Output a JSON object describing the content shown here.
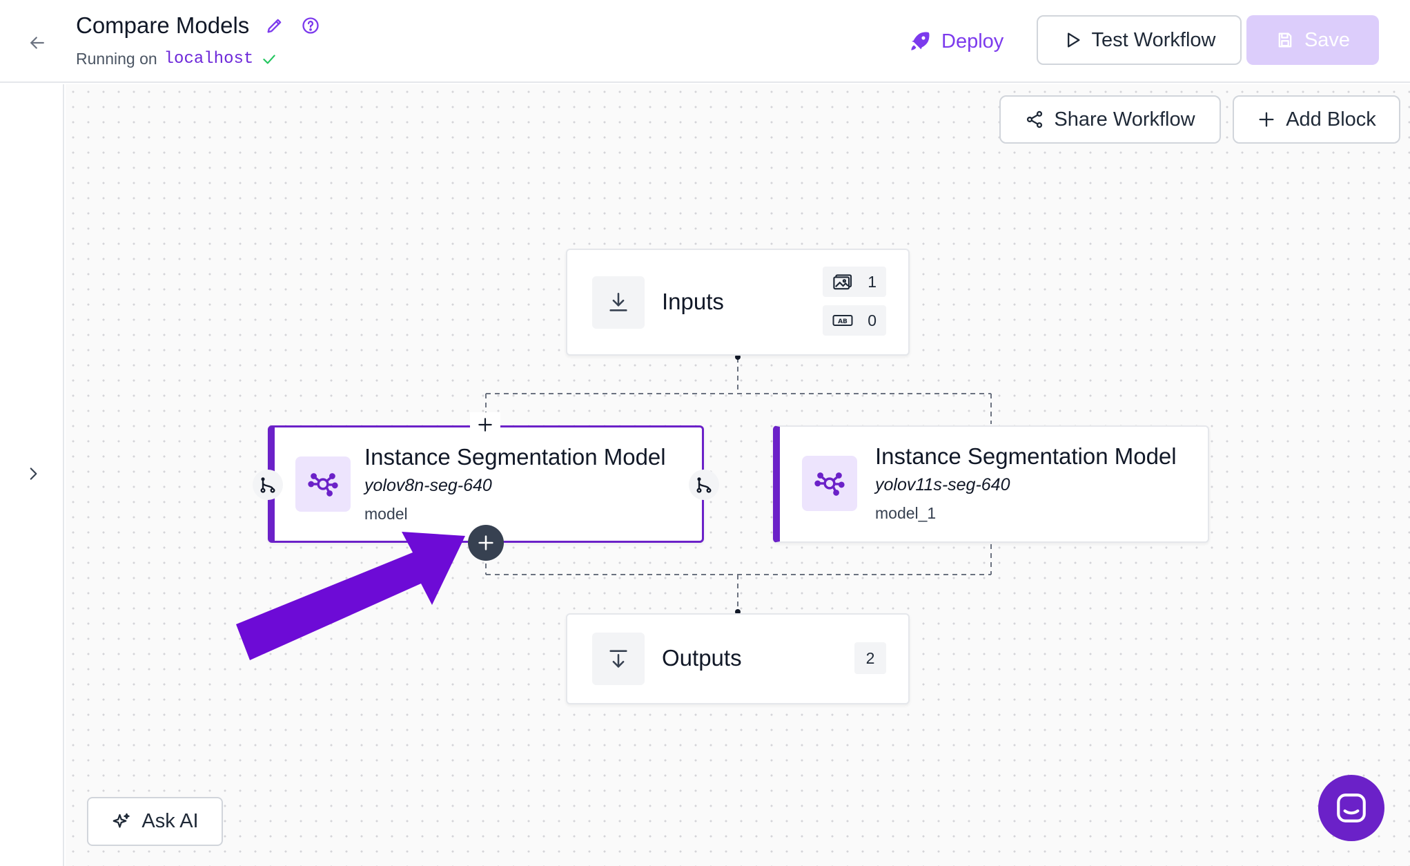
{
  "header": {
    "title": "Compare Models",
    "running_prefix": "Running on",
    "host": "localhost",
    "deploy_label": "Deploy",
    "test_label": "Test Workflow",
    "save_label": "Save"
  },
  "toolbar": {
    "share_label": "Share Workflow",
    "add_block_label": "Add Block"
  },
  "nodes": {
    "inputs": {
      "label": "Inputs",
      "image_count": "1",
      "param_count": "0"
    },
    "model1": {
      "title": "Instance Segmentation Model",
      "model_id": "yolov8n-seg-640",
      "name": "model"
    },
    "model2": {
      "title": "Instance Segmentation Model",
      "model_id": "yolov11s-seg-640",
      "name": "model_1"
    },
    "outputs": {
      "label": "Outputs",
      "count": "2"
    }
  },
  "ask_ai_label": "Ask AI",
  "colors": {
    "accent": "#7c3aed",
    "block_border": "#6b21c8",
    "arrow": "#6d0bd6"
  },
  "icons": [
    "back-arrow-icon",
    "pencil-icon",
    "help-icon",
    "check-icon",
    "rocket-icon",
    "play-icon",
    "save-icon",
    "share-icon",
    "plus-icon",
    "chevron-right-icon",
    "download-icon",
    "image-icon",
    "text-icon",
    "model-graph-icon",
    "branch-icon",
    "sparkle-icon",
    "chat-icon"
  ]
}
